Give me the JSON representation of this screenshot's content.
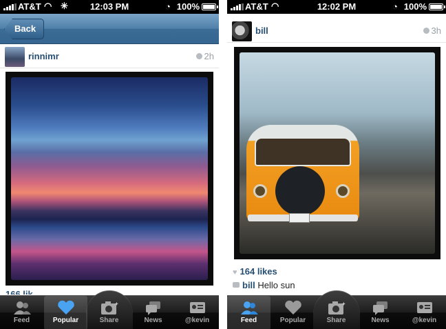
{
  "left": {
    "status": {
      "carrier": "AT&T",
      "time": "12:03 PM",
      "battery": "100%"
    },
    "nav": {
      "back_label": "Back"
    },
    "post": {
      "username": "rinnimr",
      "time_ago": "2h",
      "caption_partial": "166 lik"
    },
    "tabs": [
      {
        "label": "Feed"
      },
      {
        "label": "Popular"
      },
      {
        "label": "Share"
      },
      {
        "label": "News"
      },
      {
        "label": "@kevin"
      }
    ],
    "active_tab": "Popular"
  },
  "right": {
    "status": {
      "carrier": "AT&T",
      "time": "12:02 PM",
      "battery": "100%"
    },
    "post": {
      "username": "bill",
      "time_ago": "3h",
      "likes": "164 likes",
      "comment_user": "bill",
      "comment_text": "Hello sun"
    },
    "tabs": [
      {
        "label": "Feed"
      },
      {
        "label": "Popular"
      },
      {
        "label": "Share"
      },
      {
        "label": "News"
      },
      {
        "label": "@kevin"
      }
    ],
    "active_tab": "Feed"
  },
  "colors": {
    "link_blue": "#264e73",
    "nav_blue": "#4f80a9",
    "active_icon_blue": "#4aa3f0"
  }
}
